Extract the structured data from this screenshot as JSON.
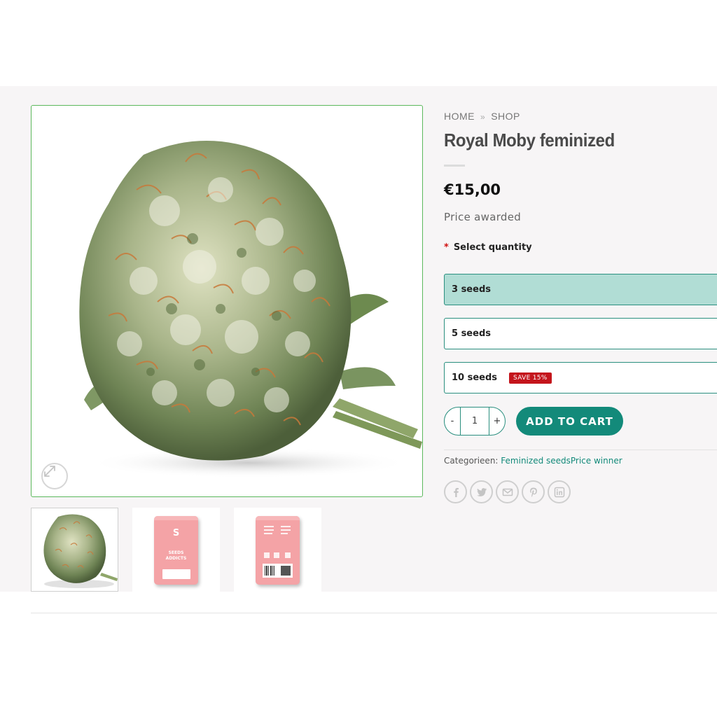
{
  "breadcrumb": {
    "home": "HOME",
    "separator": "»",
    "shop": "SHOP"
  },
  "product": {
    "title": "Royal Moby feminized",
    "price": "€15,00",
    "price_note": "Price awarded"
  },
  "variation": {
    "label": "Select quantity",
    "required_mark": "*",
    "options": [
      {
        "label": "3 seeds",
        "selected": true
      },
      {
        "label": "5 seeds",
        "selected": false
      },
      {
        "label": "10 seeds",
        "selected": false,
        "badge": "SAVE 15%"
      }
    ]
  },
  "cart": {
    "minus": "-",
    "quantity": "1",
    "plus": "+",
    "button_label": "ADD TO CART"
  },
  "meta": {
    "categories_label": "Categorieen:",
    "category_1": "Feminized seeds",
    "category_2": "Price winner"
  },
  "gallery": {
    "pack_brand_line1": "SEEDS",
    "pack_brand_line2": "ADDICTS"
  },
  "share_icons": [
    "facebook-icon",
    "twitter-icon",
    "email-icon",
    "pinterest-icon",
    "linkedin-icon"
  ],
  "colors": {
    "accent": "#138a7a",
    "selected_option": "#b1ddd5",
    "badge": "#c4151c",
    "image_border": "#5cb85c"
  }
}
